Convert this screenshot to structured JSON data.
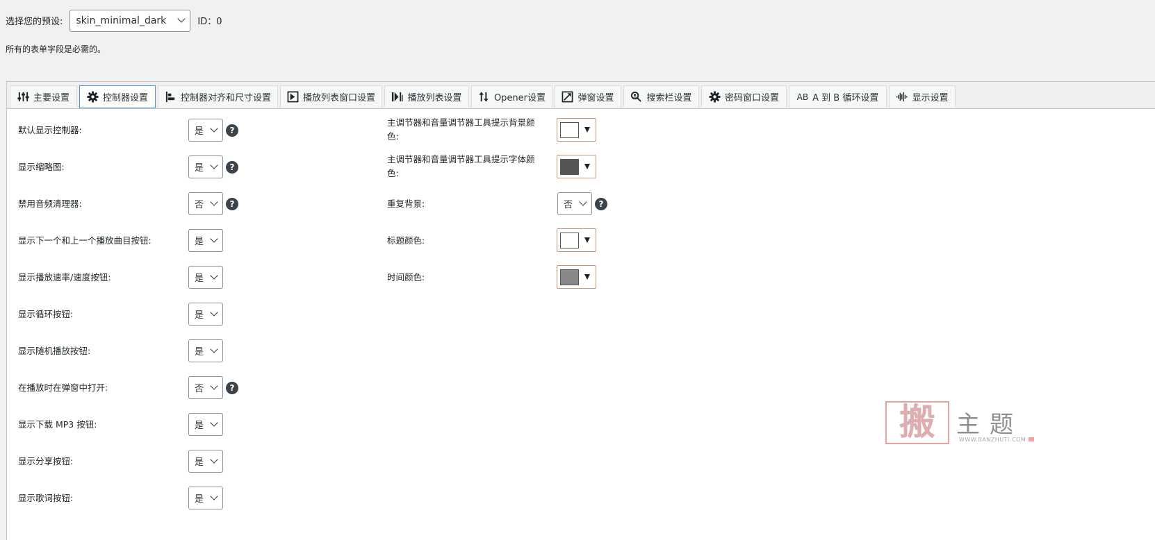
{
  "header": {
    "preset_label": "选择您的预设:",
    "preset_value": "skin_minimal_dark",
    "id_text": "ID：0",
    "required_note": "所有的表单字段是必需的。"
  },
  "tabs": [
    {
      "label": "主要设置",
      "icon": "sliders-icon"
    },
    {
      "label": "控制器设置",
      "icon": "gear-icon",
      "active": true
    },
    {
      "label": "控制器对齐和尺寸设置",
      "icon": "align-icon"
    },
    {
      "label": "播放列表窗口设置",
      "icon": "playlist-window-icon"
    },
    {
      "label": "播放列表设置",
      "icon": "playlist-icon"
    },
    {
      "label": "Opener设置",
      "icon": "sort-arrows-icon"
    },
    {
      "label": "弹窗设置",
      "icon": "popup-icon"
    },
    {
      "label": "搜索栏设置",
      "icon": "search-icon"
    },
    {
      "label": "密码窗口设置",
      "icon": "gear-icon"
    },
    {
      "label": "A 到 B 循环设置",
      "icon": "ab-icon",
      "icon_text": "AB"
    },
    {
      "label": "显示设置",
      "icon": "waveform-icon"
    }
  ],
  "left_settings": [
    {
      "label": "默认显示控制器:",
      "value": "是",
      "help": true
    },
    {
      "label": "显示缩略图:",
      "value": "是",
      "help": true
    },
    {
      "label": "禁用音频清理器:",
      "value": "否",
      "help": true
    },
    {
      "label": "显示下一个和上一个播放曲目按钮:",
      "value": "是",
      "help": false
    },
    {
      "label": "显示播放速率/速度按钮:",
      "value": "是",
      "help": false
    },
    {
      "label": "显示循环按钮:",
      "value": "是",
      "help": false
    },
    {
      "label": "显示随机播放按钮:",
      "value": "是",
      "help": false
    },
    {
      "label": "在播放时在弹窗中打开:",
      "value": "否",
      "help": true
    },
    {
      "label": "显示下载 MP3 按钮:",
      "value": "是",
      "help": false
    },
    {
      "label": "显示分享按钮:",
      "value": "是",
      "help": false
    },
    {
      "label": "显示歌词按钮:",
      "value": "是",
      "help": false
    }
  ],
  "right_settings": [
    {
      "label": "主调节器和音量调节器工具提示背景颜色:",
      "type": "color",
      "color": "#ffffff"
    },
    {
      "label": "主调节器和音量调节器工具提示字体颜色:",
      "type": "color",
      "color": "#555555"
    },
    {
      "label": "重复背景:",
      "type": "select",
      "value": "否",
      "help": true
    },
    {
      "label": "标题颜色:",
      "type": "color",
      "color": "#ffffff"
    },
    {
      "label": "时间颜色:",
      "type": "color",
      "color": "#888888"
    }
  ],
  "help_glyph": "?",
  "watermark": {
    "char": "搬",
    "text": "主题",
    "url": "WWW.BANZHUTI.COM"
  }
}
